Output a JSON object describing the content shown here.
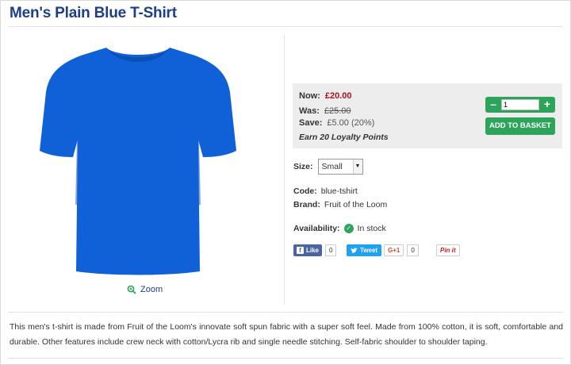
{
  "product": {
    "title": "Men's Plain Blue T-Shirt",
    "image_color": "#1060d8",
    "zoom_label": "Zoom",
    "description": "This men's t-shirt is made from Fruit of the Loom's innovate soft spun fabric with a super soft feel. Made from 100% cotton, it is soft, comfortable and durable. Other features include crew neck with cotton/Lycra rib and single needle stitching. Self-fabric shoulder to shoulder taping."
  },
  "pricing": {
    "now_label": "Now:",
    "now_value": "£20.00",
    "was_label": "Was:",
    "was_value": "£25.00",
    "save_label": "Save:",
    "save_value": "£5.00 (20%)",
    "loyalty": "Earn 20 Loyalty Points"
  },
  "purchase": {
    "minus": "–",
    "plus": "+",
    "quantity": "1",
    "add_to_basket": "ADD TO BASKET",
    "accent": "#2ea35a"
  },
  "options": {
    "size_label": "Size:",
    "size_value": "Small"
  },
  "specs": {
    "code_label": "Code:",
    "code_value": "blue-tshirt",
    "brand_label": "Brand:",
    "brand_value": "Fruit of the Loom"
  },
  "availability": {
    "label": "Availability:",
    "value": "In stock"
  },
  "social": {
    "like_label": "Like",
    "like_count": "0",
    "tweet_label": "Tweet",
    "gplus_label": "G+1",
    "gplus_count": "0",
    "pin_label": "Pin it"
  }
}
